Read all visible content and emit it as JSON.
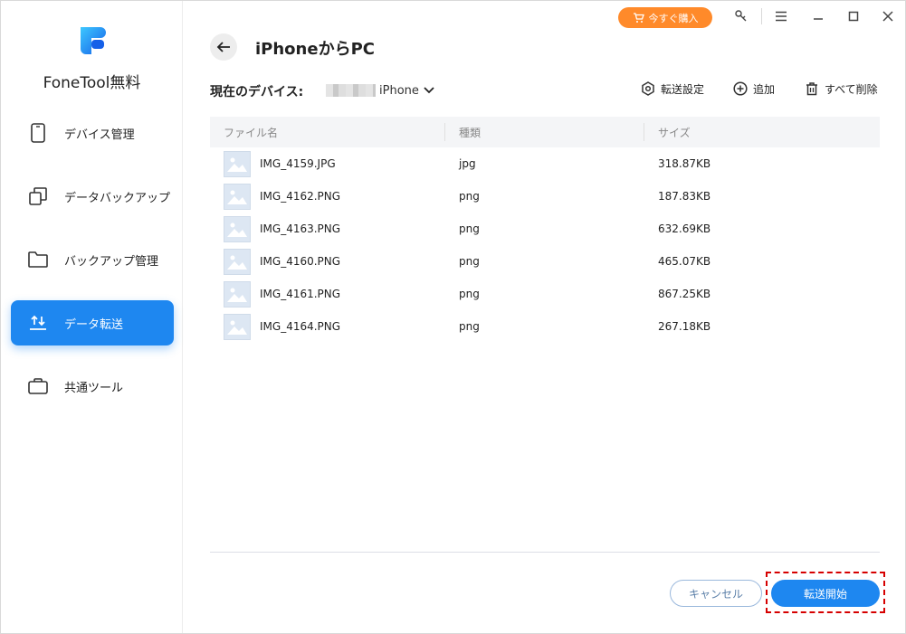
{
  "app": {
    "brand": "FoneTool無料"
  },
  "sidebar": {
    "items": [
      {
        "label": "デバイス管理",
        "icon": "phone-icon"
      },
      {
        "label": "データバックアップ",
        "icon": "copy-icon"
      },
      {
        "label": "バックアップ管理",
        "icon": "folder-icon"
      },
      {
        "label": "データ転送",
        "icon": "transfer-icon",
        "active": true
      },
      {
        "label": "共通ツール",
        "icon": "toolbox-icon"
      }
    ]
  },
  "titlebar": {
    "buy_label": "今すぐ購入"
  },
  "header": {
    "title": "iPhoneからPC",
    "device_label": "現在のデバイス:",
    "device_name": "iPhone",
    "actions": {
      "settings": "転送設定",
      "add": "追加",
      "delete_all": "すべて削除"
    }
  },
  "table": {
    "columns": [
      "ファイル名",
      "種類",
      "サイズ"
    ],
    "rows": [
      {
        "name": "IMG_4159.JPG",
        "type": "jpg",
        "size": "318.87KB"
      },
      {
        "name": "IMG_4162.PNG",
        "type": "png",
        "size": "187.83KB"
      },
      {
        "name": "IMG_4163.PNG",
        "type": "png",
        "size": "632.69KB"
      },
      {
        "name": "IMG_4160.PNG",
        "type": "png",
        "size": "465.07KB"
      },
      {
        "name": "IMG_4161.PNG",
        "type": "png",
        "size": "867.25KB"
      },
      {
        "name": "IMG_4164.PNG",
        "type": "png",
        "size": "267.18KB"
      }
    ]
  },
  "footer": {
    "cancel_label": "キャンセル",
    "start_label": "転送開始"
  },
  "colors": {
    "accent": "#1e87f0",
    "buy": "#ff8a2a",
    "highlight": "#d60000"
  }
}
